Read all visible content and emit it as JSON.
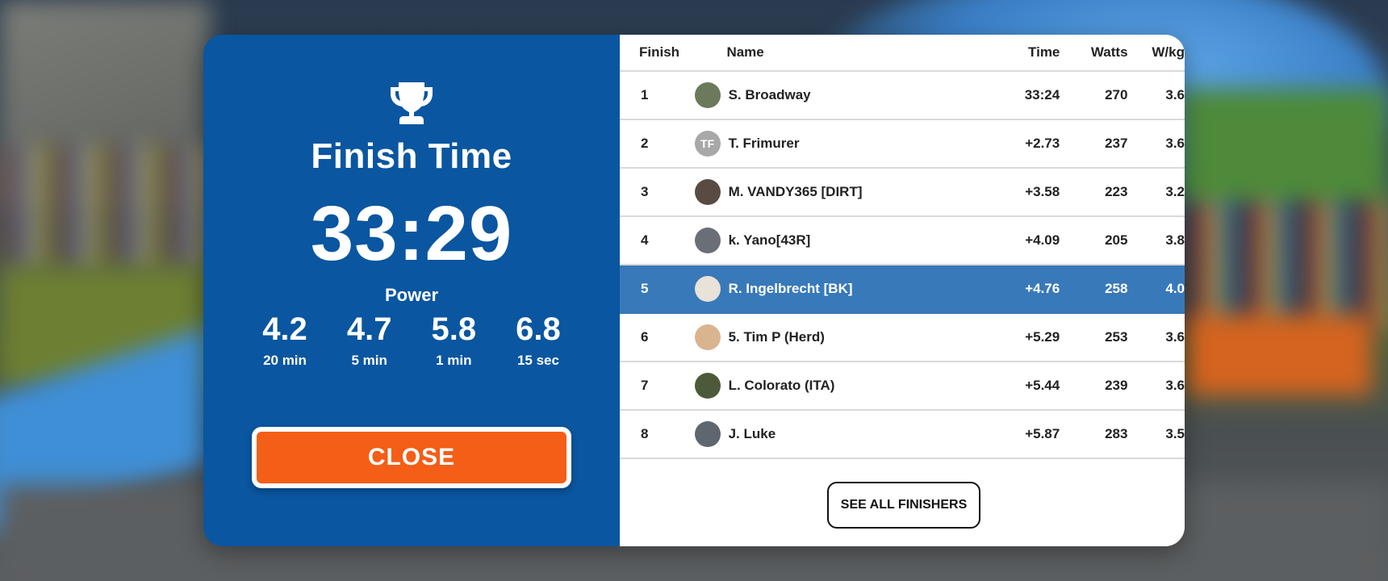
{
  "left_panel": {
    "title": "Finish Time",
    "finish_time": "33:29",
    "power_label": "Power",
    "power_stats": [
      {
        "value": "4.2",
        "duration": "20 min"
      },
      {
        "value": "4.7",
        "duration": "5 min"
      },
      {
        "value": "5.8",
        "duration": "1 min"
      },
      {
        "value": "6.8",
        "duration": "15 sec"
      }
    ],
    "close_label": "CLOSE",
    "trophy_icon": "trophy-icon"
  },
  "results": {
    "headers": {
      "finish": "Finish",
      "name": "Name",
      "time": "Time",
      "watts": "Watts",
      "wkg": "W/kg"
    },
    "rows": [
      {
        "finish": "1",
        "name": "S. Broadway",
        "time": "33:24",
        "watts": "270",
        "wkg": "3.6",
        "avatar": "",
        "avatar_color": "#6b7a5a"
      },
      {
        "finish": "2",
        "name": "T. Frimurer",
        "time": "+2.73",
        "watts": "237",
        "wkg": "3.6",
        "avatar": "TF",
        "avatar_color": "#a8a8a8"
      },
      {
        "finish": "3",
        "name": "M. VANDY365 [DIRT]",
        "time": "+3.58",
        "watts": "223",
        "wkg": "3.2",
        "avatar": "",
        "avatar_color": "#5a4a44"
      },
      {
        "finish": "4",
        "name": "k. Yano[43R]",
        "time": "+4.09",
        "watts": "205",
        "wkg": "3.8",
        "avatar": "",
        "avatar_color": "#6a6e76"
      },
      {
        "finish": "5",
        "name": "R. Ingelbrecht [BK]",
        "time": "+4.76",
        "watts": "258",
        "wkg": "4.0",
        "avatar": "",
        "avatar_color": "#e9e2d8",
        "highlight": true
      },
      {
        "finish": "6",
        "name": "5. Tim P (Herd)",
        "time": "+5.29",
        "watts": "253",
        "wkg": "3.6",
        "avatar": "",
        "avatar_color": "#d9b48f"
      },
      {
        "finish": "7",
        "name": "L. Colorato (ITA)",
        "time": "+5.44",
        "watts": "239",
        "wkg": "3.6",
        "avatar": "",
        "avatar_color": "#4d5a3a"
      },
      {
        "finish": "8",
        "name": "J. Luke",
        "time": "+5.87",
        "watts": "283",
        "wkg": "3.5",
        "avatar": "",
        "avatar_color": "#5e6670"
      }
    ],
    "see_all_label": "SEE ALL FINISHERS"
  },
  "colors": {
    "panel_blue": "#0a56a0",
    "highlight_row": "#3879b9",
    "close_orange": "#f45e17"
  }
}
